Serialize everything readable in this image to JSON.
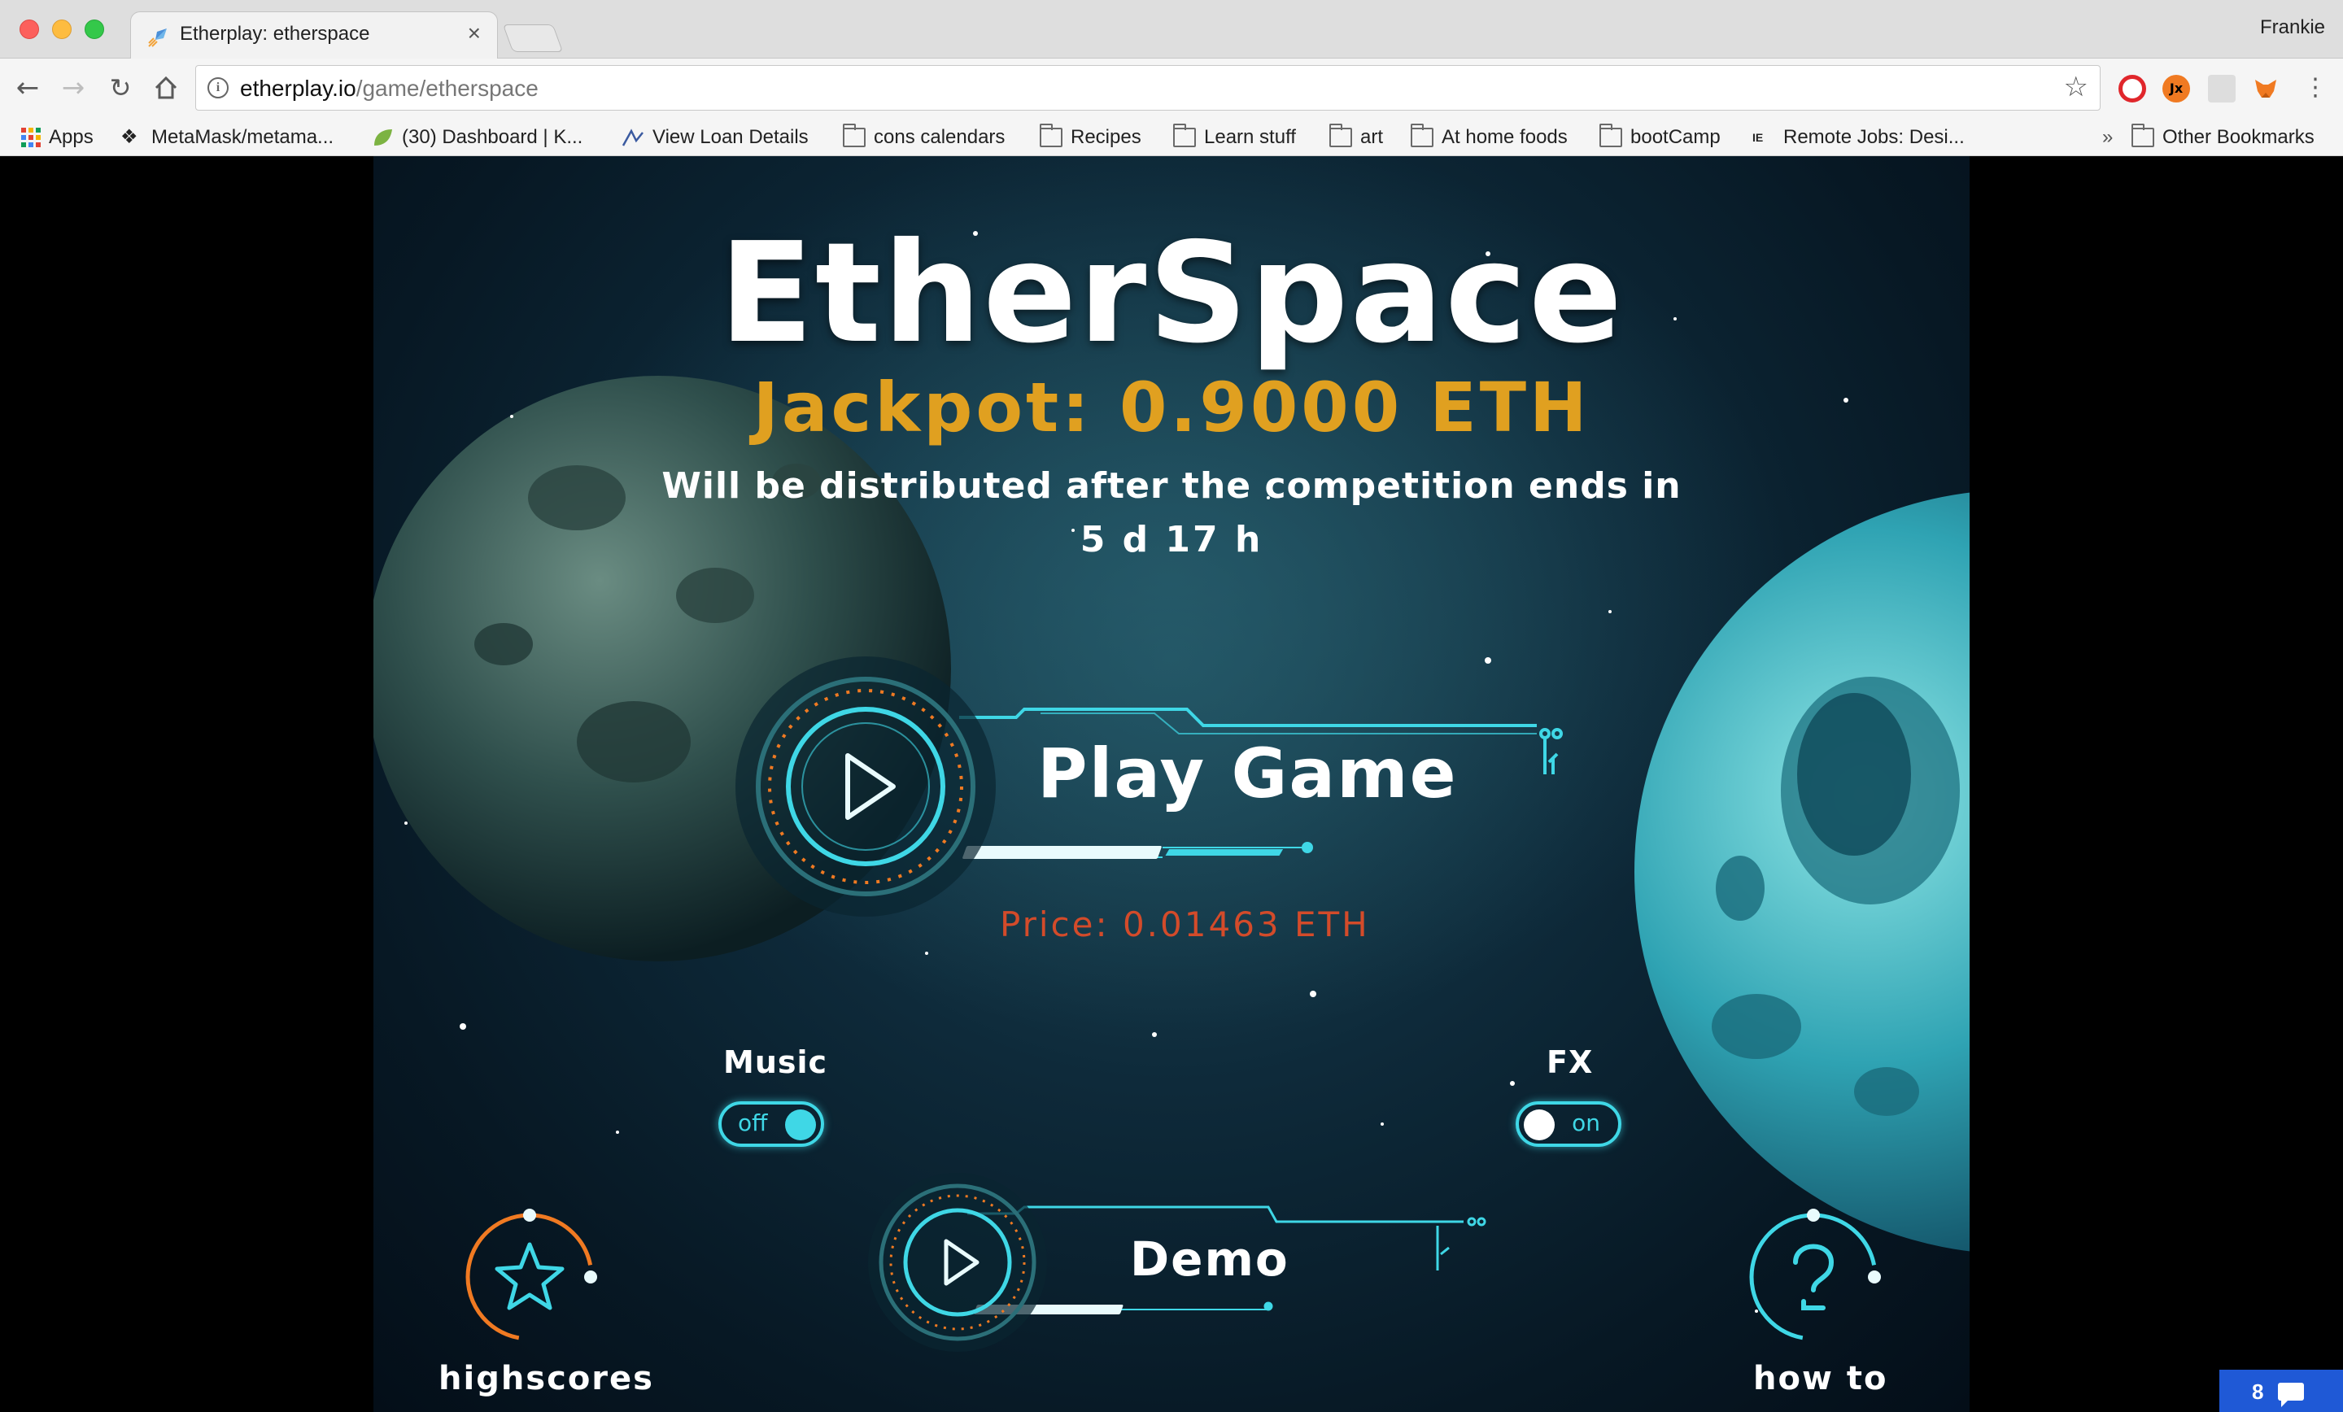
{
  "browser": {
    "tab_title": "Etherplay: etherspace",
    "tab_close": "×",
    "profile_name": "Frankie",
    "url_host": "etherplay.io",
    "url_path": "/game/etherspace",
    "bookmarks": [
      {
        "label": "Apps",
        "icon": "apps-grid-icon"
      },
      {
        "label": "MetaMask/metama...",
        "icon": "github-icon"
      },
      {
        "label": "(30) Dashboard | K...",
        "icon": "leaf-icon"
      },
      {
        "label": "View Loan Details",
        "icon": "chart-icon"
      },
      {
        "label": "cons calendars",
        "icon": "folder-icon"
      },
      {
        "label": "Recipes",
        "icon": "folder-icon"
      },
      {
        "label": "Learn stuff",
        "icon": "folder-icon"
      },
      {
        "label": "art",
        "icon": "folder-icon"
      },
      {
        "label": "At home foods",
        "icon": "folder-icon"
      },
      {
        "label": "bootCamp",
        "icon": "folder-icon"
      },
      {
        "label": "Remote Jobs: Desi...",
        "icon": "page-icon"
      }
    ],
    "overflow": "»",
    "other_bookmarks": "Other Bookmarks"
  },
  "game": {
    "title": "EtherSpace",
    "jackpot": "Jackpot: 0.9000 ETH",
    "distribution_text": "Will be distributed after the competition ends in",
    "time_remaining": "5 d 17 h",
    "play_label": "Play Game",
    "price": "Price: 0.01463 ETH",
    "music_label": "Music",
    "music_state": "off",
    "fx_label": "FX",
    "fx_state": "on",
    "demo_label": "Demo",
    "highscores_label": "highscores",
    "howto_label": "how to"
  },
  "chat_widget": {
    "count": "8"
  },
  "colors": {
    "accent_cyan": "#3fd7e6",
    "jackpot_gold": "#e0a020",
    "price_red": "#d34b2a",
    "orange_ring": "#f07a22"
  }
}
